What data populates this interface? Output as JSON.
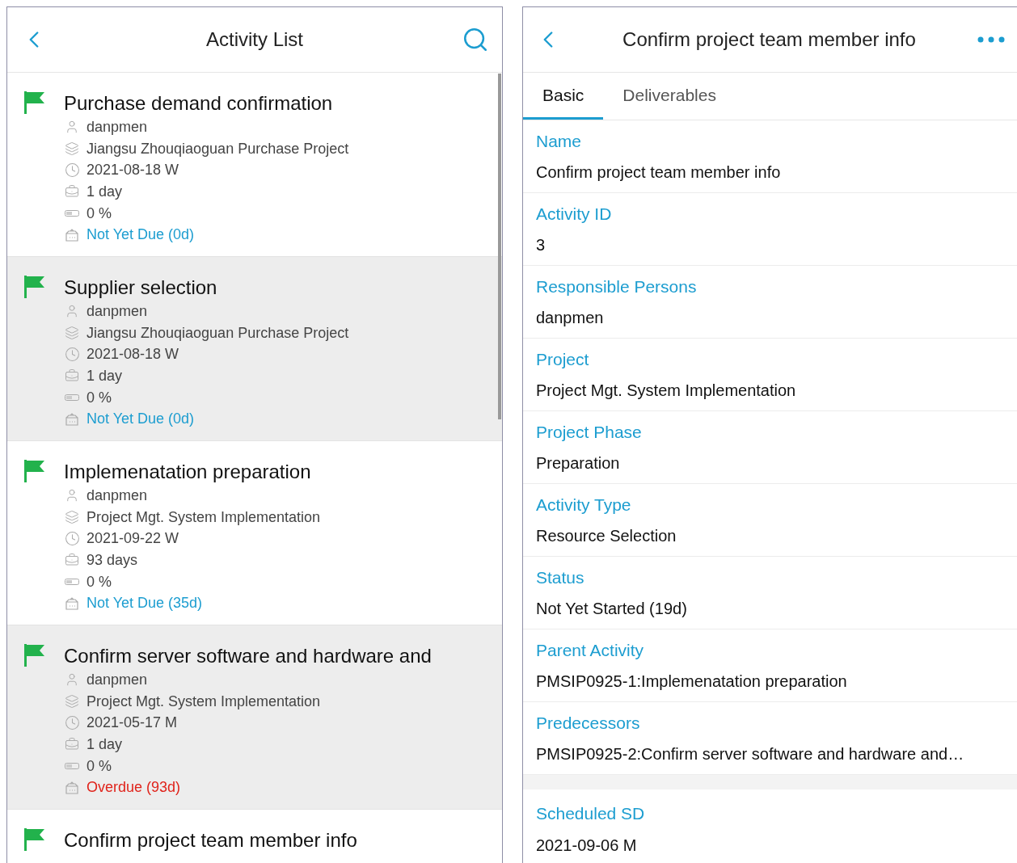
{
  "list_screen": {
    "title": "Activity List",
    "activities": [
      {
        "title": "Purchase demand confirmation",
        "person": "danpmen",
        "project": "Jiangsu Zhouqiaoguan Purchase Project",
        "date": "2021-08-18 W",
        "duration": "1 day",
        "progress": "0 %",
        "status": {
          "text": "Not Yet Due (0d)",
          "kind": "not_due"
        }
      },
      {
        "title": "Supplier selection",
        "person": "danpmen",
        "project": "Jiangsu Zhouqiaoguan Purchase Project",
        "date": "2021-08-18 W",
        "duration": "1 day",
        "progress": "0 %",
        "status": {
          "text": "Not Yet Due (0d)",
          "kind": "not_due"
        }
      },
      {
        "title": "Implemenatation preparation",
        "person": "danpmen",
        "project": "Project Mgt. System Implementation",
        "date": "2021-09-22 W",
        "duration": "93 days",
        "progress": "0 %",
        "status": {
          "text": "Not Yet Due (35d)",
          "kind": "not_due"
        }
      },
      {
        "title": "Confirm server software and hardware and",
        "person": "danpmen",
        "project": "Project Mgt. System Implementation",
        "date": "2021-05-17 M",
        "duration": "1 day",
        "progress": "0 %",
        "status": {
          "text": "Overdue (93d)",
          "kind": "overdue"
        }
      },
      {
        "title": "Confirm project team member info"
      }
    ]
  },
  "detail_screen": {
    "title": "Confirm project team member info",
    "tabs": [
      {
        "label": "Basic",
        "selected": true
      },
      {
        "label": "Deliverables",
        "selected": false
      }
    ],
    "fields": [
      {
        "label": "Name",
        "value": "Confirm project team member info"
      },
      {
        "label": "Activity ID",
        "value": "3"
      },
      {
        "label": "Responsible Persons",
        "value": "danpmen"
      },
      {
        "label": "Project",
        "value": "Project Mgt. System Implementation"
      },
      {
        "label": "Project Phase",
        "value": "Preparation"
      },
      {
        "label": "Activity Type",
        "value": "Resource Selection"
      },
      {
        "label": "Status",
        "value": "Not Yet Started (19d)"
      },
      {
        "label": "Parent Activity",
        "value": "PMSIP0925-1:Implemenatation preparation"
      },
      {
        "label": "Predecessors",
        "value": "PMSIP0925-2:Confirm server software and hardware and…"
      }
    ],
    "fields_after_gap": [
      {
        "label": "Scheduled SD",
        "value": "2021-09-06 M"
      }
    ]
  }
}
